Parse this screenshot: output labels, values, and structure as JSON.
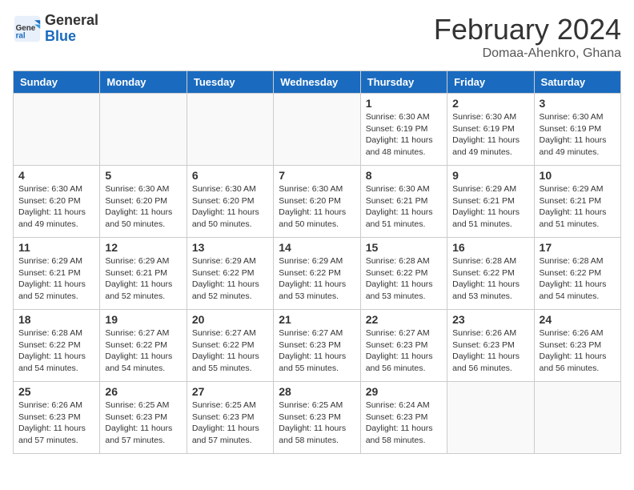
{
  "logo": {
    "general": "General",
    "blue": "Blue"
  },
  "title": "February 2024",
  "subtitle": "Domaa-Ahenkro, Ghana",
  "days": [
    "Sunday",
    "Monday",
    "Tuesday",
    "Wednesday",
    "Thursday",
    "Friday",
    "Saturday"
  ],
  "weeks": [
    [
      {
        "day": "",
        "info": ""
      },
      {
        "day": "",
        "info": ""
      },
      {
        "day": "",
        "info": ""
      },
      {
        "day": "",
        "info": ""
      },
      {
        "day": "1",
        "info": "Sunrise: 6:30 AM\nSunset: 6:19 PM\nDaylight: 11 hours\nand 48 minutes."
      },
      {
        "day": "2",
        "info": "Sunrise: 6:30 AM\nSunset: 6:19 PM\nDaylight: 11 hours\nand 49 minutes."
      },
      {
        "day": "3",
        "info": "Sunrise: 6:30 AM\nSunset: 6:19 PM\nDaylight: 11 hours\nand 49 minutes."
      }
    ],
    [
      {
        "day": "4",
        "info": "Sunrise: 6:30 AM\nSunset: 6:20 PM\nDaylight: 11 hours\nand 49 minutes."
      },
      {
        "day": "5",
        "info": "Sunrise: 6:30 AM\nSunset: 6:20 PM\nDaylight: 11 hours\nand 50 minutes."
      },
      {
        "day": "6",
        "info": "Sunrise: 6:30 AM\nSunset: 6:20 PM\nDaylight: 11 hours\nand 50 minutes."
      },
      {
        "day": "7",
        "info": "Sunrise: 6:30 AM\nSunset: 6:20 PM\nDaylight: 11 hours\nand 50 minutes."
      },
      {
        "day": "8",
        "info": "Sunrise: 6:30 AM\nSunset: 6:21 PM\nDaylight: 11 hours\nand 51 minutes."
      },
      {
        "day": "9",
        "info": "Sunrise: 6:29 AM\nSunset: 6:21 PM\nDaylight: 11 hours\nand 51 minutes."
      },
      {
        "day": "10",
        "info": "Sunrise: 6:29 AM\nSunset: 6:21 PM\nDaylight: 11 hours\nand 51 minutes."
      }
    ],
    [
      {
        "day": "11",
        "info": "Sunrise: 6:29 AM\nSunset: 6:21 PM\nDaylight: 11 hours\nand 52 minutes."
      },
      {
        "day": "12",
        "info": "Sunrise: 6:29 AM\nSunset: 6:21 PM\nDaylight: 11 hours\nand 52 minutes."
      },
      {
        "day": "13",
        "info": "Sunrise: 6:29 AM\nSunset: 6:22 PM\nDaylight: 11 hours\nand 52 minutes."
      },
      {
        "day": "14",
        "info": "Sunrise: 6:29 AM\nSunset: 6:22 PM\nDaylight: 11 hours\nand 53 minutes."
      },
      {
        "day": "15",
        "info": "Sunrise: 6:28 AM\nSunset: 6:22 PM\nDaylight: 11 hours\nand 53 minutes."
      },
      {
        "day": "16",
        "info": "Sunrise: 6:28 AM\nSunset: 6:22 PM\nDaylight: 11 hours\nand 53 minutes."
      },
      {
        "day": "17",
        "info": "Sunrise: 6:28 AM\nSunset: 6:22 PM\nDaylight: 11 hours\nand 54 minutes."
      }
    ],
    [
      {
        "day": "18",
        "info": "Sunrise: 6:28 AM\nSunset: 6:22 PM\nDaylight: 11 hours\nand 54 minutes."
      },
      {
        "day": "19",
        "info": "Sunrise: 6:27 AM\nSunset: 6:22 PM\nDaylight: 11 hours\nand 54 minutes."
      },
      {
        "day": "20",
        "info": "Sunrise: 6:27 AM\nSunset: 6:22 PM\nDaylight: 11 hours\nand 55 minutes."
      },
      {
        "day": "21",
        "info": "Sunrise: 6:27 AM\nSunset: 6:23 PM\nDaylight: 11 hours\nand 55 minutes."
      },
      {
        "day": "22",
        "info": "Sunrise: 6:27 AM\nSunset: 6:23 PM\nDaylight: 11 hours\nand 56 minutes."
      },
      {
        "day": "23",
        "info": "Sunrise: 6:26 AM\nSunset: 6:23 PM\nDaylight: 11 hours\nand 56 minutes."
      },
      {
        "day": "24",
        "info": "Sunrise: 6:26 AM\nSunset: 6:23 PM\nDaylight: 11 hours\nand 56 minutes."
      }
    ],
    [
      {
        "day": "25",
        "info": "Sunrise: 6:26 AM\nSunset: 6:23 PM\nDaylight: 11 hours\nand 57 minutes."
      },
      {
        "day": "26",
        "info": "Sunrise: 6:25 AM\nSunset: 6:23 PM\nDaylight: 11 hours\nand 57 minutes."
      },
      {
        "day": "27",
        "info": "Sunrise: 6:25 AM\nSunset: 6:23 PM\nDaylight: 11 hours\nand 57 minutes."
      },
      {
        "day": "28",
        "info": "Sunrise: 6:25 AM\nSunset: 6:23 PM\nDaylight: 11 hours\nand 58 minutes."
      },
      {
        "day": "29",
        "info": "Sunrise: 6:24 AM\nSunset: 6:23 PM\nDaylight: 11 hours\nand 58 minutes."
      },
      {
        "day": "",
        "info": ""
      },
      {
        "day": "",
        "info": ""
      }
    ]
  ]
}
